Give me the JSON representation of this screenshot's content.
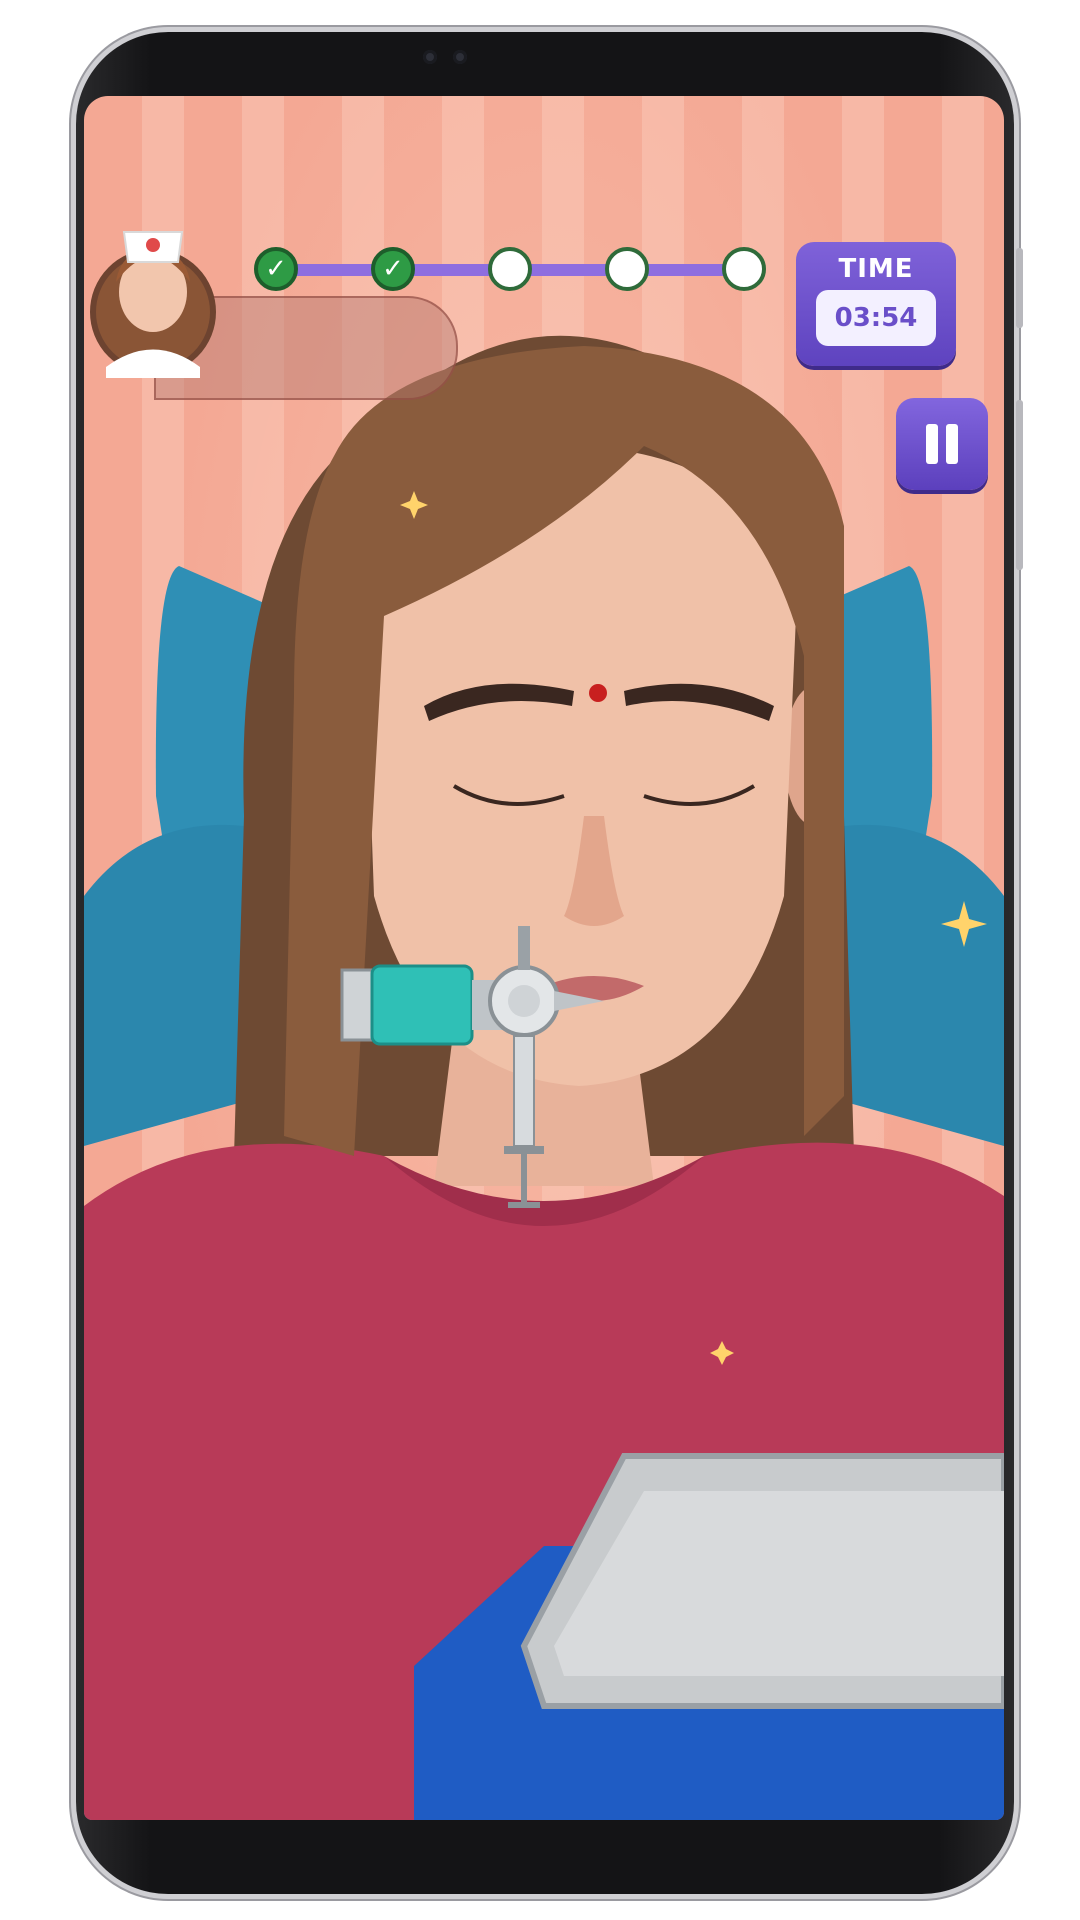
{
  "game": {
    "timer_label": "TIME",
    "timer_value": "03:54",
    "progress_steps": [
      {
        "status": "done",
        "icon": "check-icon"
      },
      {
        "status": "done",
        "icon": "check-icon"
      },
      {
        "status": "pending",
        "icon": ""
      },
      {
        "status": "pending",
        "icon": ""
      },
      {
        "status": "pending",
        "icon": ""
      }
    ],
    "check_glyph": "✓",
    "pause_icon": "pause-icon",
    "colors": {
      "accent": "#6a4fc9",
      "step_done": "#2e9b45",
      "background_stripe": "#f4a894",
      "shirt": "#b83a58",
      "chair": "#2f8fb5"
    }
  }
}
